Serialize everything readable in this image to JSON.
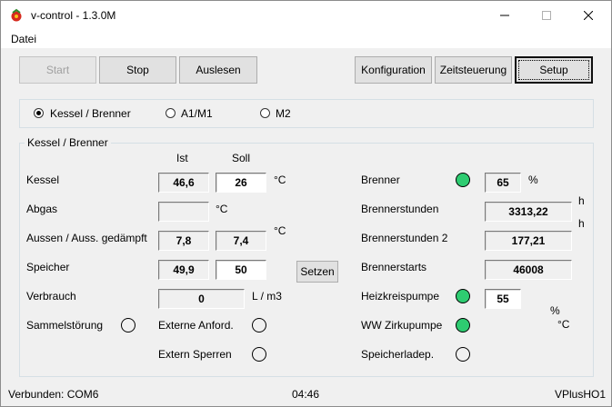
{
  "window": {
    "title": "v-control - 1.3.0M"
  },
  "menu": {
    "datei": "Datei"
  },
  "toolbar": {
    "start": "Start",
    "stop": "Stop",
    "auslesen": "Auslesen",
    "konfiguration": "Konfiguration",
    "zeitsteuerung": "Zeitsteuerung",
    "setup": "Setup"
  },
  "circuits": {
    "options": [
      "Kessel / Brenner",
      "A1/M1",
      "M2"
    ],
    "selected": "Kessel / Brenner"
  },
  "group": {
    "title": "Kessel / Brenner",
    "col_ist": "Ist",
    "col_soll": "Soll",
    "kessel": {
      "label": "Kessel",
      "ist": "46,6",
      "soll": "26",
      "unit": "°C"
    },
    "abgas": {
      "label": "Abgas",
      "ist": "",
      "unit": "°C"
    },
    "aussen": {
      "label": "Aussen / Auss. gedämpft",
      "ist": "7,8",
      "soll": "7,4",
      "unit": "°C"
    },
    "speicher": {
      "label": "Speicher",
      "ist": "49,9",
      "soll": "50",
      "set_button": "Setzen"
    },
    "verbrauch": {
      "label": "Verbrauch",
      "value": "0",
      "unit": "L / m3"
    },
    "sammelstoerung": {
      "label": "Sammelstörung",
      "state": "off"
    },
    "externe_anford": {
      "label": "Externe Anford.",
      "state": "off"
    },
    "extern_sperren": {
      "label": "Extern Sperren",
      "state": "off"
    },
    "brenner": {
      "label": "Brenner",
      "value": "65",
      "unit": "%",
      "state": "on"
    },
    "brennerstunden": {
      "label": "Brennerstunden",
      "value": "3313,22",
      "unit": "h"
    },
    "brennerstunden2": {
      "label": "Brennerstunden 2",
      "value": "177,21",
      "unit": "h"
    },
    "brennerstarts": {
      "label": "Brennerstarts",
      "value": "46008"
    },
    "heizkreispumpe": {
      "label": "Heizkreispumpe",
      "value": "55",
      "unit": "%",
      "state": "on"
    },
    "ww_zirkupumpe": {
      "label": "WW Zirkupumpe",
      "unit": "°C",
      "state": "on"
    },
    "speicherladep": {
      "label": "Speicherladep.",
      "state": "off"
    }
  },
  "status": {
    "connection": "Verbunden: COM6",
    "time": "04:46",
    "device": "VPlusHO1"
  },
  "colors": {
    "led_on": "#2ecc71",
    "led_off": "#f0f0f0",
    "window_bg": "#f0f0f0"
  }
}
